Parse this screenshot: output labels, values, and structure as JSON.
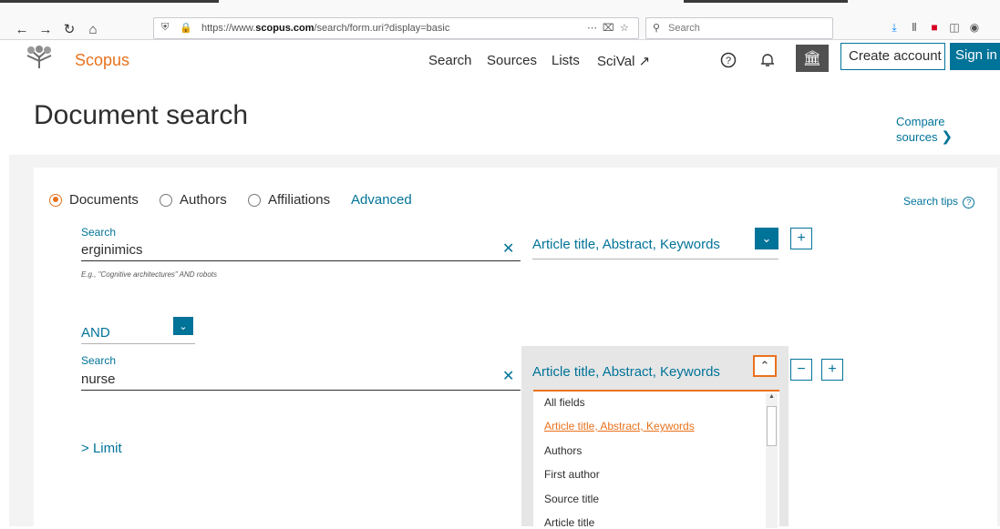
{
  "browser": {
    "url_prefix": "https://www.",
    "url_domain": "scopus.com",
    "url_suffix": "/search/form.uri?display=basic",
    "search_placeholder": "Search",
    "more_icon": "⋯",
    "pocket_icon": "⌧",
    "star_icon": "☆"
  },
  "header": {
    "brand": "Scopus",
    "nav": [
      "Search",
      "Sources",
      "Lists",
      "SciVal ↗"
    ],
    "create_account": "Create account",
    "sign_in": "Sign in"
  },
  "page": {
    "title": "Document search",
    "compare_sources": "Compare sources",
    "search_tips": "Search tips"
  },
  "search_types": {
    "options": [
      "Documents",
      "Authors",
      "Affiliations"
    ],
    "selected": "Documents",
    "advanced": "Advanced"
  },
  "rows": [
    {
      "label": "Search",
      "value": "erginimics",
      "scope": "Article title, Abstract, Keywords",
      "example": "E.g., \"Cognitive architectures\" AND robots"
    },
    {
      "label": "Search",
      "value": "nurse",
      "scope": "Article title, Abstract, Keywords"
    }
  ],
  "operator": "AND",
  "limit": "Limit",
  "dropdown": {
    "items": [
      "All fields",
      "Article title, Abstract, Keywords",
      "Authors",
      "First author",
      "Source title",
      "Article title"
    ],
    "active": "Article title, Abstract, Keywords"
  },
  "colors": {
    "accent": "#007398",
    "brand": "#e9711c"
  }
}
